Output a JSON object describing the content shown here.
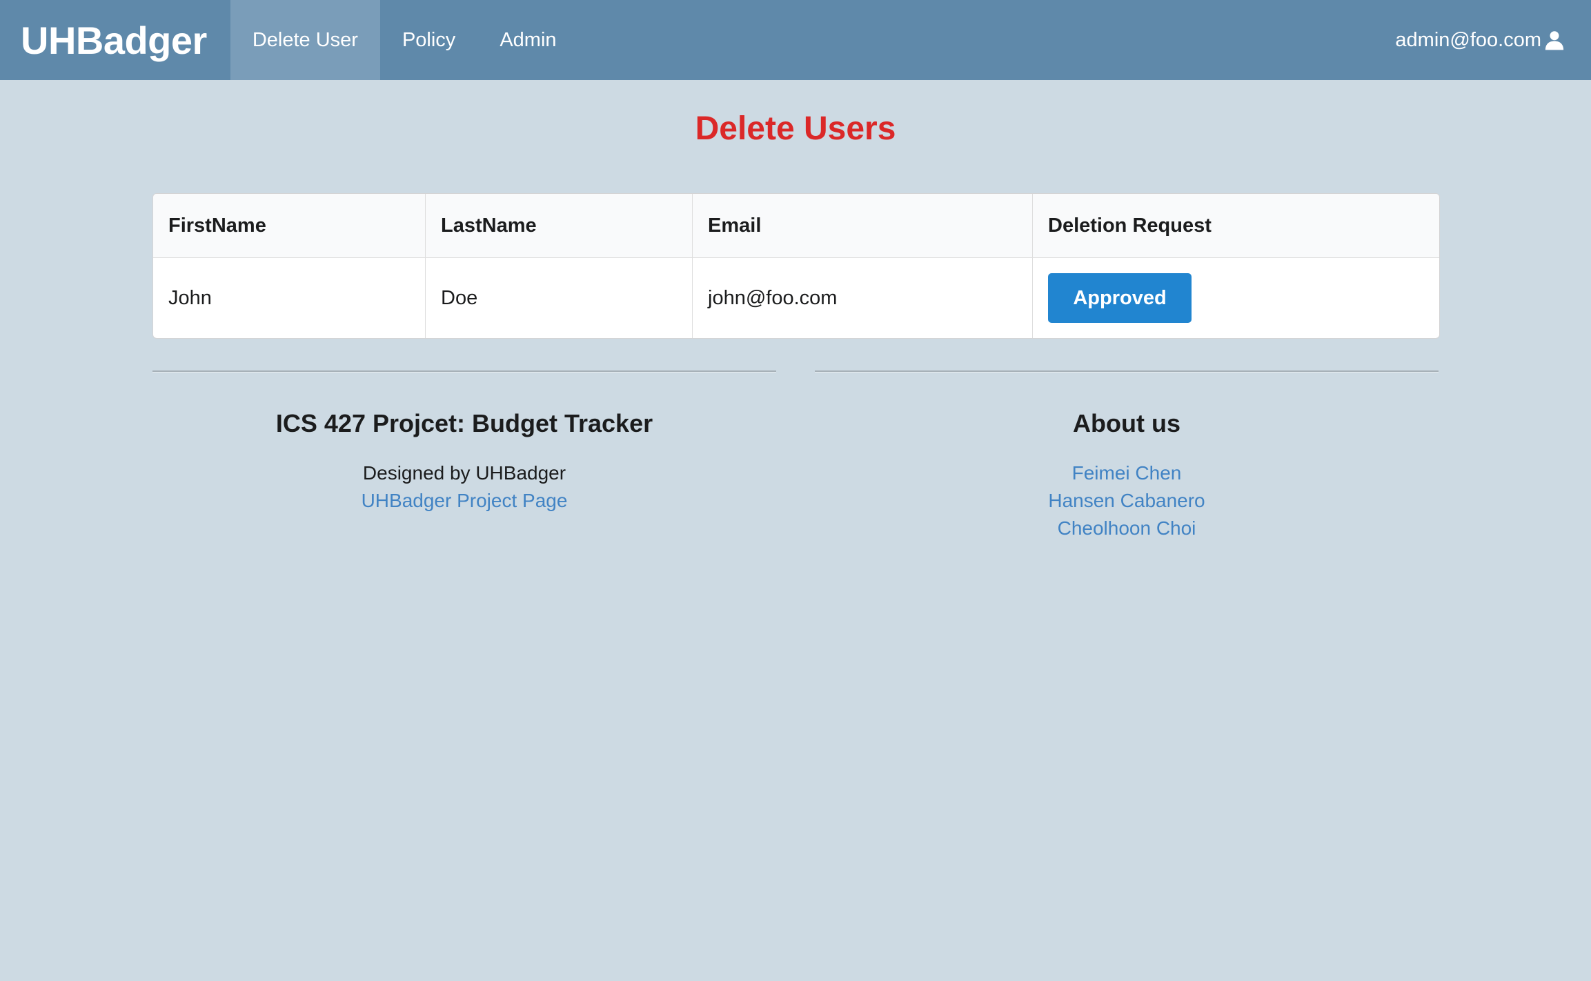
{
  "navbar": {
    "brand": "UHBadger",
    "items": [
      {
        "label": "Delete User",
        "active": true
      },
      {
        "label": "Policy",
        "active": false
      },
      {
        "label": "Admin",
        "active": false
      }
    ],
    "user_email": "admin@foo.com",
    "user_icon": "user-icon"
  },
  "page": {
    "title": "Delete Users"
  },
  "table": {
    "headers": [
      "FirstName",
      "LastName",
      "Email",
      "Deletion Request"
    ],
    "rows": [
      {
        "first_name": "John",
        "last_name": "Doe",
        "email": "john@foo.com",
        "action": "Approved"
      }
    ]
  },
  "footer": {
    "left": {
      "heading": "ICS 427 Projcet: Budget Tracker",
      "designed_by": "Designed by UHBadger",
      "link": "UHBadger Project Page"
    },
    "right": {
      "heading": "About us",
      "members": [
        "Feimei Chen",
        "Hansen Cabanero",
        "Cheolhoon Choi"
      ]
    }
  },
  "colors": {
    "navbar_bg": "#5f89aa",
    "nav_active_bg": "#7a9db9",
    "page_bg": "#cddae3",
    "title_red": "#db2828",
    "button_blue": "#2185d0",
    "link_blue": "#4183c4"
  }
}
